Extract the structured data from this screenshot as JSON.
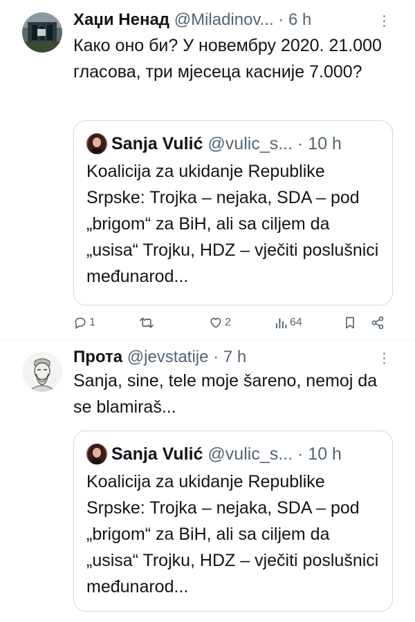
{
  "tweets": [
    {
      "author": {
        "name": "Хаџи Ненад",
        "handle": "@Miladinov...",
        "avatar": "stadium-photo-avatar"
      },
      "dot": "·",
      "time": "6 h",
      "text": "Како оно би? У новембру 2020. 21.000 гласова, три мјесеца касније 7.000?",
      "quote": {
        "author": {
          "name": "Sanja Vulić",
          "handle": "@vulic_s...",
          "avatar": "woman-portrait-avatar"
        },
        "dot": "·",
        "time": "10 h",
        "text": "Koalicija za ukidanje Republike Srpske: Trojka – nejaka, SDA – pod „brigom“ za BiH, ali sa ciljem da „usisa“ Trojku, HDZ – vječiti poslušnici međunarod..."
      },
      "actions": {
        "reply_count": "1",
        "retweet_count": "",
        "like_count": "2",
        "view_count": "64"
      }
    },
    {
      "author": {
        "name": "Прота",
        "handle": "@jevstatije",
        "avatar": "sketch-portrait-avatar"
      },
      "dot": "·",
      "time": "7 h",
      "text": "Sanja, sine, tele moje šareno, nemoj da se blamiraš...",
      "quote": {
        "author": {
          "name": "Sanja Vulić",
          "handle": "@vulic_s...",
          "avatar": "woman-portrait-avatar"
        },
        "dot": "·",
        "time": "10 h",
        "text": "Koalicija za ukidanje Republike Srpske: Trojka – nejaka, SDA – pod „brigom“ za BiH, ali sa ciljem da „usisa“ Trojku, HDZ – vječiti poslušnici međunarod..."
      }
    }
  ],
  "colors": {
    "text": "#0f1419",
    "secondary": "#536471",
    "border": "#cfd9de",
    "divider": "#eff3f4"
  },
  "icons": [
    "reply-icon",
    "retweet-icon",
    "like-icon",
    "views-icon",
    "bookmark-icon",
    "share-icon",
    "more-options-icon"
  ]
}
